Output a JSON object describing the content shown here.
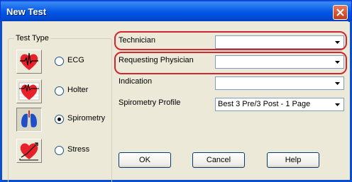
{
  "window": {
    "title": "New Test"
  },
  "test_type": {
    "legend": "Test Type",
    "options": [
      {
        "label": "ECG",
        "icon": "ecg-heart-icon",
        "checked": false
      },
      {
        "label": "Holter",
        "icon": "holter-monitor-icon",
        "checked": false
      },
      {
        "label": "Spirometry",
        "icon": "lungs-icon",
        "checked": true
      },
      {
        "label": "Stress",
        "icon": "stress-heart-icon",
        "checked": false
      }
    ]
  },
  "fields": {
    "technician": {
      "label": "Technician",
      "value": ""
    },
    "requesting_physician": {
      "label": "Requesting Physician",
      "value": ""
    },
    "indication": {
      "label": "Indication",
      "value": ""
    },
    "spirometry_profile": {
      "label": "Spirometry Profile",
      "value": "Best 3 Pre/3 Post - 1 Page"
    }
  },
  "buttons": {
    "ok": "OK",
    "cancel": "Cancel",
    "help": "Help"
  },
  "colors": {
    "titlebar": "#0055e5",
    "highlight": "#d0272d",
    "dialog_bg": "#ece9d8",
    "heart": "#e8202a",
    "lungs": "#1f4fc8"
  }
}
